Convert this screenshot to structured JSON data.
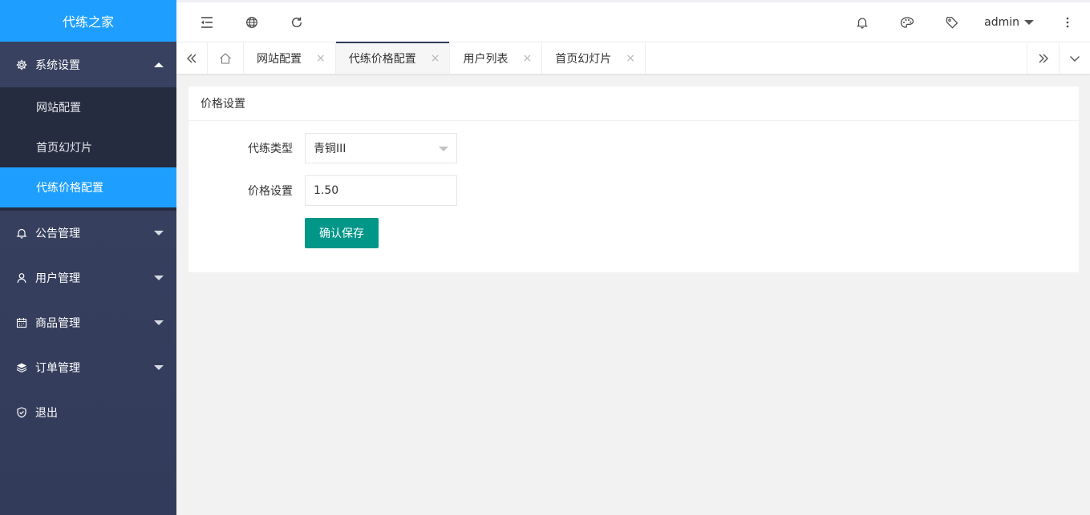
{
  "app": {
    "title": "代练之家"
  },
  "sidebar": {
    "groups": [
      {
        "label": "系统设置",
        "icon": "gear-icon",
        "expanded": true,
        "items": [
          {
            "label": "网站配置",
            "active": false
          },
          {
            "label": "首页幻灯片",
            "active": false
          },
          {
            "label": "代练价格配置",
            "active": true
          }
        ]
      },
      {
        "label": "公告管理",
        "icon": "bell-icon",
        "expanded": false
      },
      {
        "label": "用户管理",
        "icon": "user-icon",
        "expanded": false
      },
      {
        "label": "商品管理",
        "icon": "calendar-icon",
        "expanded": false
      },
      {
        "label": "订单管理",
        "icon": "layers-icon",
        "expanded": false
      },
      {
        "label": "退出",
        "icon": "shield-icon",
        "expanded": false
      }
    ]
  },
  "header": {
    "user": "admin",
    "icons": [
      "menu-fold-icon",
      "globe-icon",
      "refresh-icon",
      "bell-icon",
      "palette-icon",
      "tag-icon",
      "more-vertical-icon"
    ]
  },
  "tabs": {
    "items": [
      {
        "label": "网站配置",
        "active": false
      },
      {
        "label": "代练价格配置",
        "active": true
      },
      {
        "label": "用户列表",
        "active": false
      },
      {
        "label": "首页幻灯片",
        "active": false
      }
    ],
    "close_glyph": "×"
  },
  "form": {
    "card_title": "价格设置",
    "type_label": "代练类型",
    "type_value": "青铜III",
    "price_label": "价格设置",
    "price_value": "1.50",
    "save_label": "确认保存"
  },
  "colors": {
    "accent": "#1e9fff",
    "sidebar_bg": "#394260",
    "save_button": "#009688"
  }
}
